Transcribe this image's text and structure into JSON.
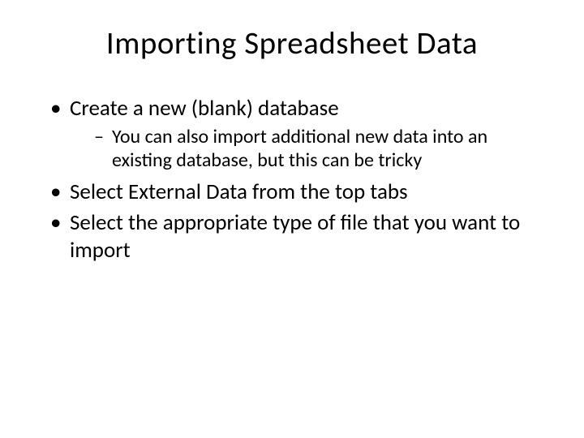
{
  "slide": {
    "title": "Importing Spreadsheet Data",
    "bullets": [
      {
        "text": "Create a new (blank) database",
        "sub": [
          "You can also import additional new data into an existing database, but this can be tricky"
        ]
      },
      {
        "text": "Select External Data from the top tabs",
        "sub": []
      },
      {
        "text": "Select the appropriate type of file that you want to import",
        "sub": []
      }
    ]
  }
}
